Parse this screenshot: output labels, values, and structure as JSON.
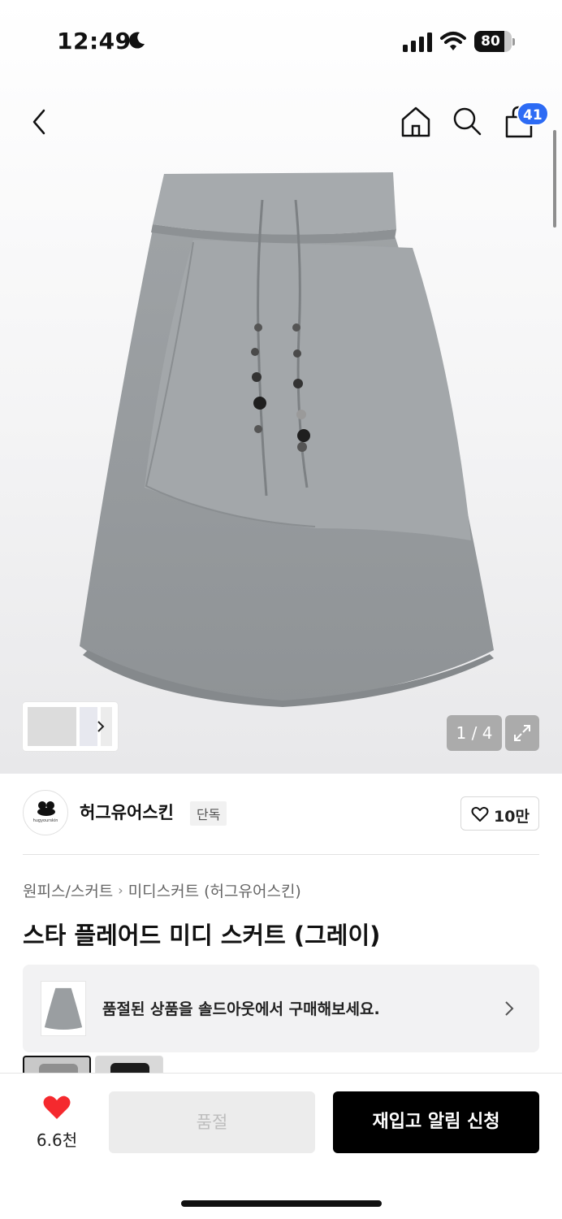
{
  "status_bar": {
    "time": "12:49",
    "moon_icon": "moon-icon",
    "signal_icon": "cellular-signal-icon",
    "wifi_icon": "wifi-icon",
    "battery_level": "80"
  },
  "top_nav": {
    "back_icon": "chevron-left-icon",
    "home_icon": "home-icon",
    "search_icon": "search-icon",
    "bag_icon": "shopping-bag-icon",
    "cart_count": "41"
  },
  "gallery": {
    "current_image": "1 / 4",
    "expand_icon": "expand-icon"
  },
  "brand": {
    "logo_text": "hugyourskin",
    "name": "허그유어스킨",
    "badge": "단독",
    "likes": "10만"
  },
  "breadcrumb": {
    "category": "원피스/스커트",
    "subcategory": "미디스커트 (허그유어스킨)"
  },
  "product": {
    "title": "스타 플레어드 미디 스커트 (그레이)",
    "soldout_banner_text": "품절된 상품을 솔드아웃에서 구매해보세요."
  },
  "bottom_bar": {
    "wish_count": "6.6천",
    "soldout_label": "품절",
    "restock_label": "재입고 알림 신청"
  },
  "colors": {
    "accent_blue": "#2d6bf4",
    "heart_red": "#f5292e",
    "primary_black": "#000000"
  }
}
